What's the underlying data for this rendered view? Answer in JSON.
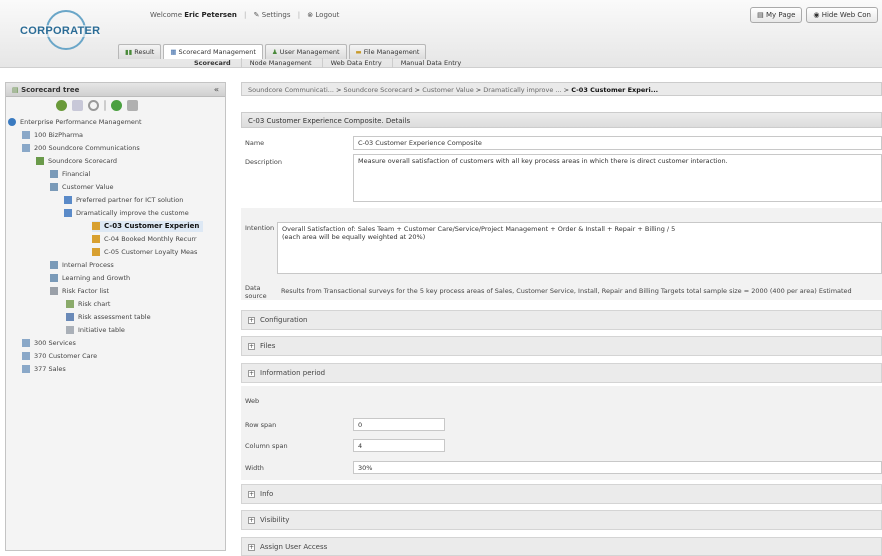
{
  "header": {
    "logo_text": "CORPORATER",
    "welcome": "Welcome",
    "user_name": "Eric Petersen",
    "settings": "Settings",
    "logout": "Logout",
    "my_page": "My Page",
    "hide_web": "Hide Web Con"
  },
  "main_tabs": [
    "Result",
    "Scorecard Management",
    "User Management",
    "File Management"
  ],
  "sub_tabs": [
    "Scorecard",
    "Node Management",
    "Web Data Entry",
    "Manual Data Entry"
  ],
  "sidebar": {
    "title": "Scorecard tree",
    "collapse": "«",
    "tree": [
      "Enterprise Performance Management",
      "100 BizPharma",
      "200 Soundcore Communications",
      "Soundcore Scorecard",
      "Financial",
      "Customer Value",
      "Preferred partner for ICT solution",
      "Dramatically improve the custome",
      "C-03 Customer Experien",
      "C-04 Booked Monthly Recurr",
      "C-05 Customer Loyalty Meas",
      "Internal Process",
      "Learning and Growth",
      "Risk Factor list",
      "Risk chart",
      "Risk assessment table",
      "Initiative table",
      "300 Services",
      "370 Customer Care",
      "377 Sales"
    ]
  },
  "breadcrumb": {
    "items": [
      "Soundcore Communicati...",
      "Soundcore Scorecard",
      "Customer Value",
      "Dramatically improve ..."
    ],
    "current": "C-03 Customer Experi..."
  },
  "detail": {
    "title": "C-03 Customer Experience Composite. Details",
    "name_label": "Name",
    "name_value": "C-03 Customer Experience Composite",
    "description_label": "Description",
    "description_value": "Measure overall satisfaction of customers with all key process areas in which there is direct customer interaction.",
    "intention_label": "Intention",
    "intention_value": "Overall Satisfaction of: Sales Team + Customer Care/Service/Project Management + Order & Install + Repair + Billing / 5\n(each area will be equally weighted at 20%)",
    "data_source_label": "Data source",
    "data_source_value": "Results from Transactional surveys for the 5 key process areas of Sales, Customer Service, Install, Repair and Billing Targets total sample size = 2000 (400 per area) Estimated",
    "sections_top": [
      "Configuration",
      "Files",
      "Information period"
    ],
    "web_label": "Web",
    "row_span_label": "Row span",
    "row_span_value": "0",
    "column_span_label": "Column span",
    "column_span_value": "4",
    "width_label": "Width",
    "width_value": "30%",
    "sections_bottom": [
      "Info",
      "Visibility",
      "Assign User Access"
    ]
  }
}
